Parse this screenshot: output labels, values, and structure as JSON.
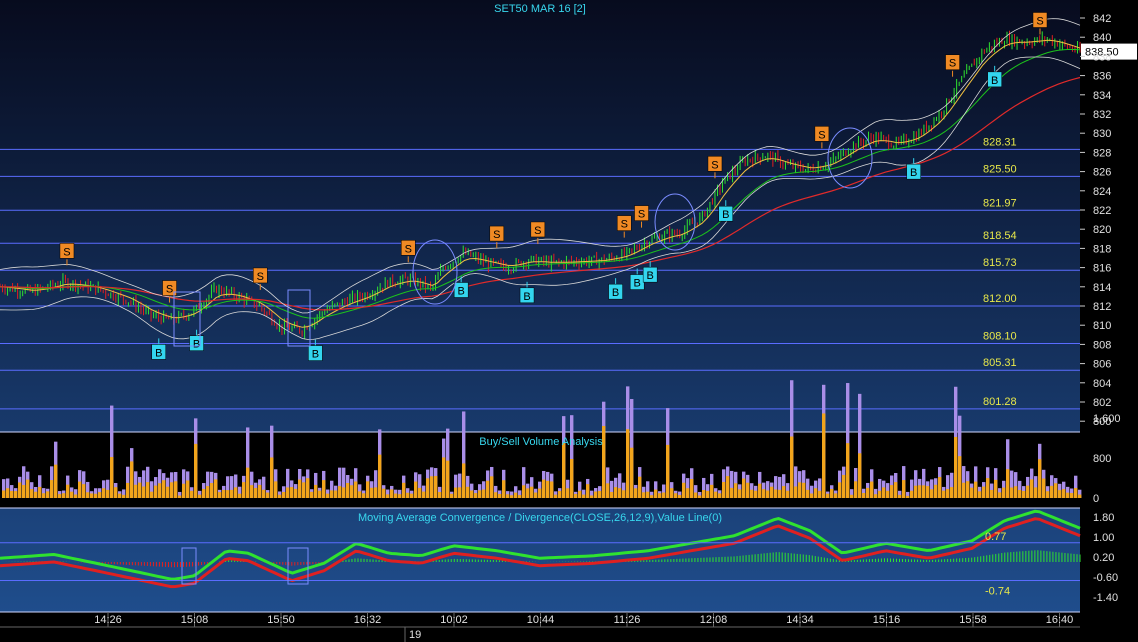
{
  "header": {
    "title": "SET50 MAR 16  [2]"
  },
  "colors": {
    "background_top": "#0a0f24",
    "background_bottom": "#1e4a86",
    "level_line": "#5a6cff",
    "level_label": "#e8e84a",
    "cyan_text": "#38d7ee",
    "buy_marker": "#33d6ef",
    "sell_marker": "#f08a24",
    "candle_up": "#2fe22f",
    "candle_down": "#e02020",
    "volume_buy": "#f2a51c",
    "volume_sell": "#a98ee8",
    "macd_positive": "#2fe22f",
    "macd_negative": "#e02020",
    "ma_red": "#e02a2a",
    "ma_green": "#1cc21c",
    "ma_orange": "#f0c040",
    "bollinger": "#d8d8d8"
  },
  "price_panel": {
    "last_price": "838.50",
    "y_ticks": [
      "842",
      "840",
      "838",
      "836",
      "834",
      "832",
      "830",
      "828",
      "826",
      "824",
      "822",
      "820",
      "818",
      "816",
      "814",
      "812",
      "810",
      "808",
      "806",
      "804",
      "802",
      "800"
    ],
    "levels": [
      "828.31",
      "825.50",
      "821.97",
      "818.54",
      "815.73",
      "812.00",
      "808.10",
      "805.31",
      "801.28"
    ]
  },
  "volume_panel": {
    "title": "Buy/Sell Volume Analysis",
    "y_ticks": [
      "1,600",
      "800",
      "0"
    ]
  },
  "macd_panel": {
    "title": "Moving Average Convergence / Divergence(CLOSE,26,12,9),Value Line(0)",
    "y_ticks": [
      "1.80",
      "1.00",
      "0.20",
      "-0.60",
      "-1.40"
    ],
    "level_values": [
      "0.77",
      "-0.74"
    ]
  },
  "x_axis": {
    "labels": [
      "14:26",
      "15:08",
      "15:50",
      "16:32",
      "10:02",
      "10:44",
      "11:26",
      "12:08",
      "14:34",
      "15:16",
      "15:58",
      "16:40"
    ],
    "date_label": "19"
  },
  "signals": {
    "sell_label": "S",
    "buy_label": "B"
  },
  "chart_data": {
    "type": "candlestick",
    "instrument": "SET50 MAR 16",
    "last": 838.5,
    "ylim": [
      800,
      843
    ],
    "levels": [
      828.31,
      825.5,
      821.97,
      818.54,
      815.73,
      812.0,
      808.1,
      805.31,
      801.28
    ],
    "close_path": [
      [
        0,
        814.0
      ],
      [
        0.03,
        813.5
      ],
      [
        0.06,
        814.5
      ],
      [
        0.09,
        813.8
      ],
      [
        0.12,
        812.5
      ],
      [
        0.14,
        811.0
      ],
      [
        0.16,
        810.5
      ],
      [
        0.18,
        811.5
      ],
      [
        0.2,
        813.8
      ],
      [
        0.22,
        813.0
      ],
      [
        0.24,
        812.0
      ],
      [
        0.26,
        809.8
      ],
      [
        0.28,
        809.5
      ],
      [
        0.3,
        811.5
      ],
      [
        0.32,
        812.5
      ],
      [
        0.34,
        813.2
      ],
      [
        0.36,
        814.5
      ],
      [
        0.38,
        814.8
      ],
      [
        0.4,
        813.8
      ],
      [
        0.41,
        816.0
      ],
      [
        0.43,
        817.5
      ],
      [
        0.45,
        816.5
      ],
      [
        0.47,
        816.0
      ],
      [
        0.49,
        816.8
      ],
      [
        0.51,
        816.5
      ],
      [
        0.53,
        816.6
      ],
      [
        0.56,
        816.8
      ],
      [
        0.58,
        817.4
      ],
      [
        0.6,
        818.8
      ],
      [
        0.62,
        819.5
      ],
      [
        0.63,
        819.6
      ],
      [
        0.65,
        821.3
      ],
      [
        0.67,
        825.0
      ],
      [
        0.69,
        827.2
      ],
      [
        0.71,
        827.7
      ],
      [
        0.73,
        826.6
      ],
      [
        0.75,
        826.2
      ],
      [
        0.77,
        827.0
      ],
      [
        0.79,
        828.7
      ],
      [
        0.81,
        829.6
      ],
      [
        0.83,
        828.8
      ],
      [
        0.85,
        829.8
      ],
      [
        0.87,
        832.0
      ],
      [
        0.89,
        835.5
      ],
      [
        0.91,
        838.5
      ],
      [
        0.93,
        839.8
      ],
      [
        0.95,
        839.5
      ],
      [
        0.97,
        839.8
      ],
      [
        1.0,
        838.5
      ]
    ],
    "sell_signals_x": [
      0.062,
      0.157,
      0.241,
      0.378,
      0.46,
      0.498,
      0.578,
      0.594,
      0.662,
      0.761,
      0.882,
      1.0
    ],
    "buy_signals_x": [
      0.147,
      0.182,
      0.292,
      0.427,
      0.488,
      0.57,
      0.59,
      0.602,
      0.672,
      0.846,
      0.921
    ],
    "volume": {
      "ylim": [
        0,
        2600
      ],
      "series": [
        {
          "name": "Buy",
          "color": "#f2a51c"
        },
        {
          "name": "Sell",
          "color": "#a98ee8"
        }
      ]
    },
    "macd": {
      "ylim": [
        -2.0,
        2.0
      ],
      "value_lines": [
        0.77,
        -0.74
      ],
      "path": [
        [
          0,
          0.0
        ],
        [
          0.05,
          0.15
        ],
        [
          0.1,
          -0.3
        ],
        [
          0.16,
          -0.85
        ],
        [
          0.18,
          -0.7
        ],
        [
          0.21,
          0.3
        ],
        [
          0.23,
          0.2
        ],
        [
          0.27,
          -0.6
        ],
        [
          0.3,
          -0.2
        ],
        [
          0.33,
          0.6
        ],
        [
          0.36,
          0.2
        ],
        [
          0.39,
          0.1
        ],
        [
          0.42,
          0.5
        ],
        [
          0.46,
          0.3
        ],
        [
          0.5,
          0.0
        ],
        [
          0.55,
          0.1
        ],
        [
          0.6,
          0.3
        ],
        [
          0.64,
          0.6
        ],
        [
          0.68,
          0.9
        ],
        [
          0.72,
          1.6
        ],
        [
          0.75,
          1.1
        ],
        [
          0.78,
          0.2
        ],
        [
          0.82,
          0.6
        ],
        [
          0.86,
          0.3
        ],
        [
          0.9,
          0.7
        ],
        [
          0.93,
          1.5
        ],
        [
          0.96,
          1.9
        ],
        [
          1.0,
          1.2
        ]
      ]
    }
  }
}
